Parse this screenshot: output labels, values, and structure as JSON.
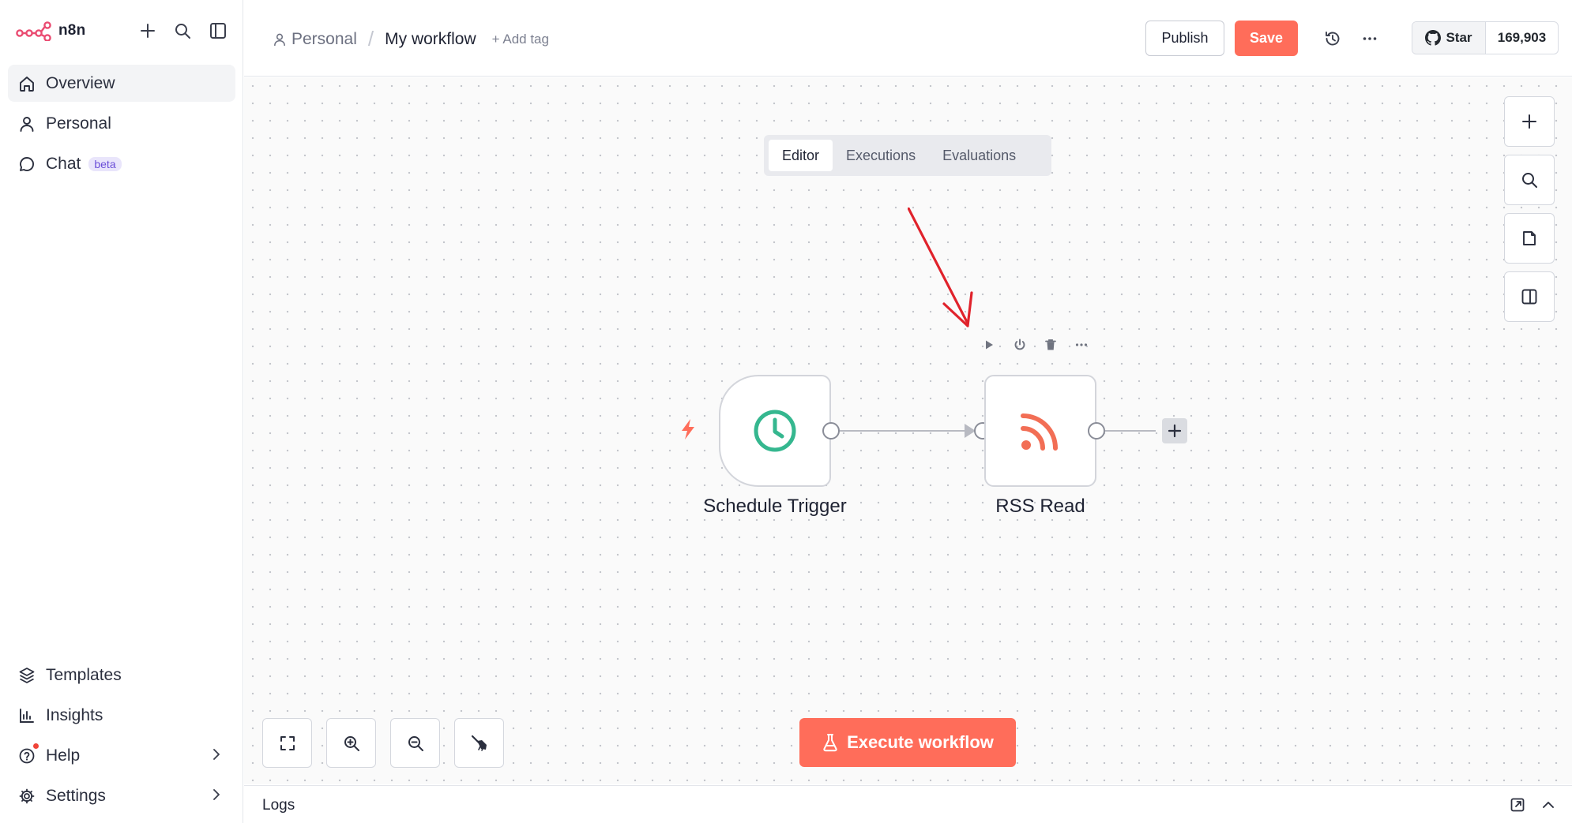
{
  "app": {
    "name": "n8n"
  },
  "sidebar": {
    "nav": [
      {
        "label": "Overview"
      },
      {
        "label": "Personal"
      },
      {
        "label": "Chat",
        "badge": "beta"
      }
    ],
    "bottom": [
      {
        "label": "Templates"
      },
      {
        "label": "Insights"
      },
      {
        "label": "Help"
      },
      {
        "label": "Settings"
      }
    ]
  },
  "header": {
    "project": "Personal",
    "separator": "/",
    "workflow_name": "My workflow",
    "add_tag": "+ Add tag",
    "publish": "Publish",
    "save": "Save",
    "github": {
      "star": "Star",
      "count": "169,903"
    }
  },
  "tabs": [
    {
      "label": "Editor"
    },
    {
      "label": "Executions"
    },
    {
      "label": "Evaluations"
    }
  ],
  "nodes": {
    "trigger": {
      "label": "Schedule Trigger"
    },
    "rss": {
      "label": "RSS Read"
    }
  },
  "canvas": {
    "execute_label": "Execute workflow"
  },
  "logs": {
    "label": "Logs"
  },
  "colors": {
    "accent": "#ff6d5a",
    "trigger_icon": "#35b78f",
    "annotation_arrow": "#e0222b"
  }
}
